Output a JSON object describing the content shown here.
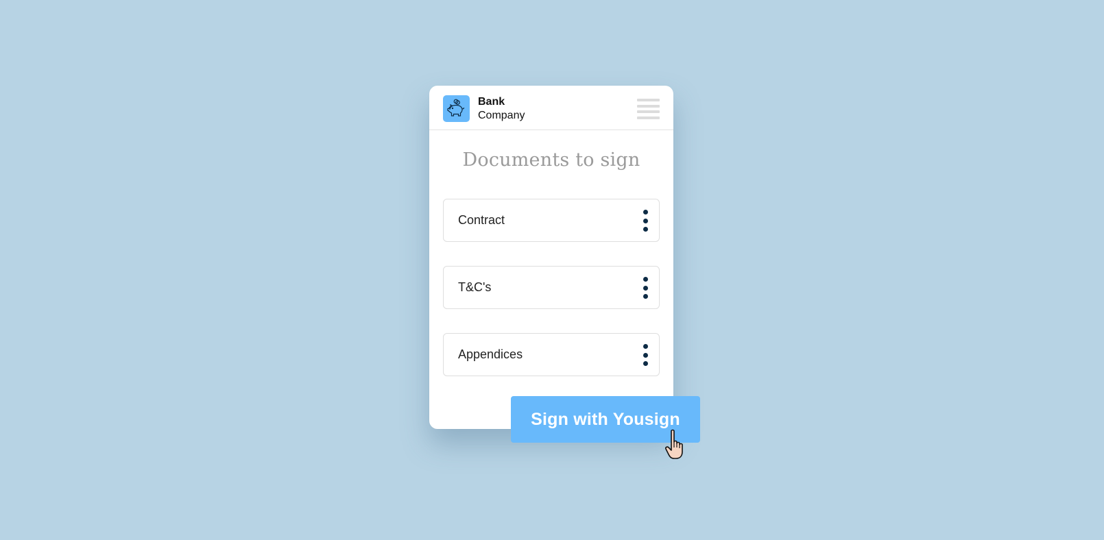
{
  "header": {
    "logo_icon": "piggy-bank-icon",
    "brand_line1": "Bank",
    "brand_line2": "Company",
    "menu_icon": "hamburger-menu-icon"
  },
  "main": {
    "title": "Documents to sign",
    "documents": [
      {
        "label": "Contract",
        "menu_icon": "kebab-menu-icon"
      },
      {
        "label": "T&C's",
        "menu_icon": "kebab-menu-icon"
      },
      {
        "label": "Appendices",
        "menu_icon": "kebab-menu-icon"
      }
    ]
  },
  "action": {
    "sign_label": "Sign with Yousign",
    "cursor_icon": "pointer-hand-icon"
  },
  "colors": {
    "background": "#b7d3e4",
    "accent": "#68b9fb",
    "kebab": "#0d2b45"
  }
}
